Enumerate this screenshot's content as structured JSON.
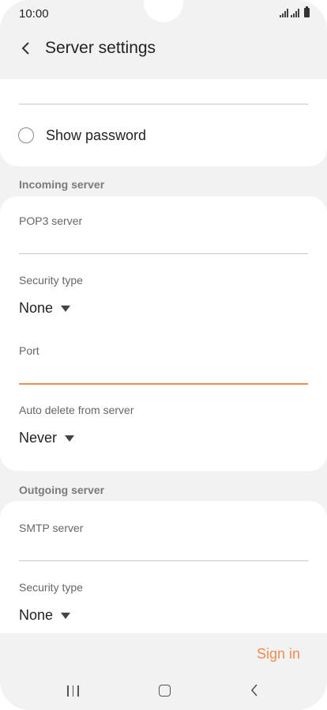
{
  "status_bar": {
    "time": "10:00"
  },
  "header": {
    "title": "Server settings",
    "back_icon": "chevron-left-icon"
  },
  "password": {
    "show_password_label": "Show password",
    "show_password_checked": false
  },
  "incoming": {
    "section_title": "Incoming server",
    "pop3_label": "POP3 server",
    "pop3_value": "",
    "security_label": "Security type",
    "security_value": "None",
    "port_label": "Port",
    "port_value": "",
    "auto_delete_label": "Auto delete from server",
    "auto_delete_value": "Never"
  },
  "outgoing": {
    "section_title": "Outgoing server",
    "smtp_label": "SMTP server",
    "smtp_value": "",
    "security_label": "Security type",
    "security_value": "None"
  },
  "footer": {
    "sign_in_label": "Sign in"
  },
  "colors": {
    "accent": "#ef8c4e",
    "background": "#f2f2f2",
    "card": "#ffffff"
  },
  "nav_bar": {
    "recents_icon": "recents-icon",
    "home_icon": "home-icon",
    "back_icon": "back-icon"
  }
}
